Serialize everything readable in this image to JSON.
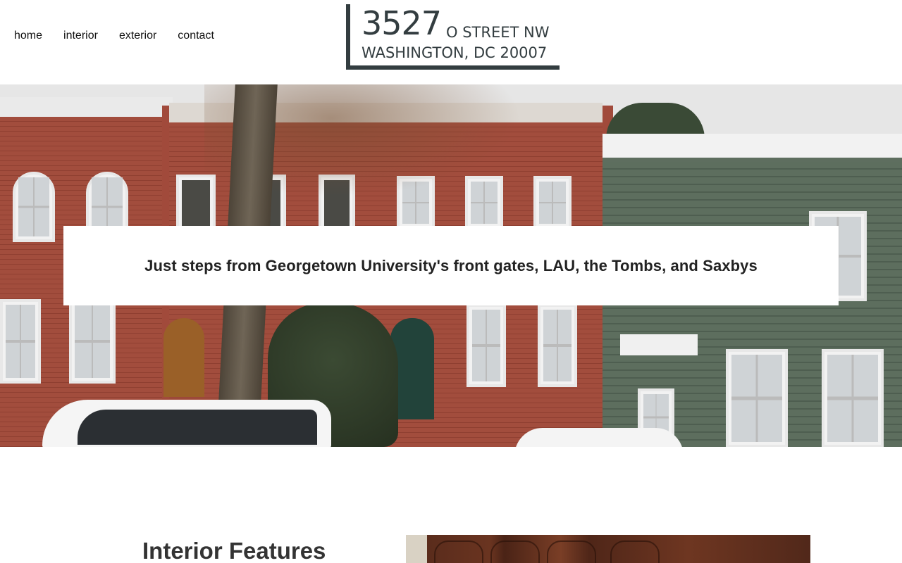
{
  "nav": {
    "items": [
      {
        "label": "home"
      },
      {
        "label": "interior"
      },
      {
        "label": "exterior"
      },
      {
        "label": "contact"
      }
    ]
  },
  "logo": {
    "number": "3527",
    "street": "O STREET NW",
    "city": "WASHINGTON, DC 20007",
    "color": "#333d40"
  },
  "hero": {
    "tagline": "Just steps from Georgetown University's front gates, LAU, the Tombs, and Saxbys",
    "image": "photo of brick and green-sided row houses on a Georgetown street with parked cars"
  },
  "features": {
    "title": "Interior Features",
    "image": "photo of dark cherry wood kitchen cabinets"
  }
}
